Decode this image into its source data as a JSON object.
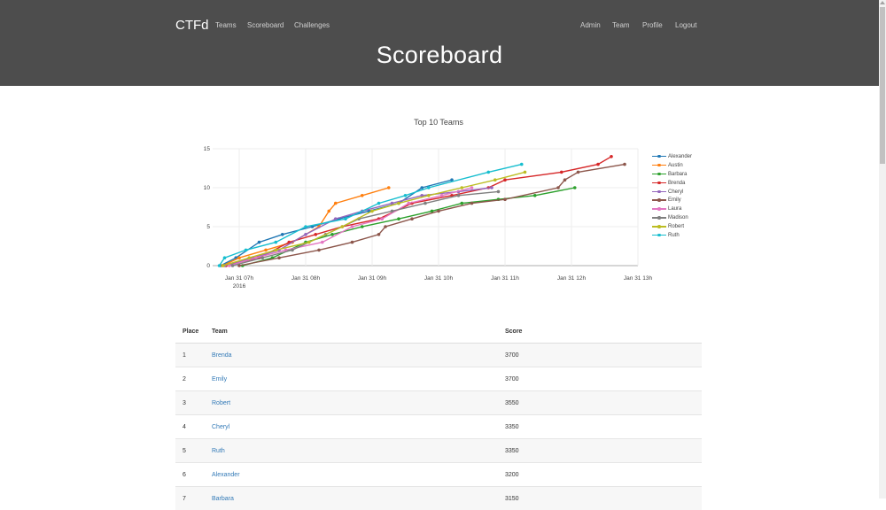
{
  "navbar": {
    "brand": "CTFd",
    "left_links": [
      "Teams",
      "Scoreboard",
      "Challenges"
    ],
    "right_links": [
      "Admin",
      "Team",
      "Profile",
      "Logout"
    ]
  },
  "page_title": "Scoreboard",
  "chart_data": {
    "type": "line",
    "title": "Top 10 Teams",
    "xlabel": "",
    "ylabel": "",
    "x_ticks": [
      "Jan 31 07h\n2016",
      "Jan 31 08h",
      "Jan 31 09h",
      "Jan 31 10h",
      "Jan 31 11h",
      "Jan 31 12h",
      "Jan 31 13h"
    ],
    "y_ticks": [
      0,
      5,
      10,
      15
    ],
    "xlim": [
      6.6,
      13.0
    ],
    "ylim": [
      0,
      15
    ],
    "grid": true,
    "legend": "right",
    "series": [
      {
        "name": "Alexander",
        "color": "#1f77b4",
        "x": [
          6.72,
          6.95,
          7.3,
          7.65,
          8.1,
          8.5,
          8.95,
          9.4,
          9.75,
          10.2
        ],
        "y": [
          0,
          1,
          3,
          4,
          5,
          6,
          7,
          8,
          10,
          11
        ]
      },
      {
        "name": "Austin",
        "color": "#ff7f0e",
        "x": [
          6.75,
          7.0,
          7.4,
          7.8,
          8.2,
          8.35,
          8.45,
          8.85,
          9.25
        ],
        "y": [
          0,
          1,
          2,
          3,
          5,
          7,
          8,
          9,
          10
        ]
      },
      {
        "name": "Barbara",
        "color": "#2ca02c",
        "x": [
          7.05,
          7.5,
          8.0,
          8.4,
          8.85,
          9.4,
          9.9,
          10.35,
          10.9,
          11.45,
          12.05
        ],
        "y": [
          0,
          1,
          3,
          4,
          5,
          6,
          7,
          8,
          8.5,
          9,
          10
        ]
      },
      {
        "name": "Brenda",
        "color": "#d62728",
        "x": [
          6.8,
          7.3,
          7.75,
          8.15,
          8.55,
          9.1,
          9.6,
          10.2,
          10.75,
          11.0,
          11.85,
          12.4,
          12.6
        ],
        "y": [
          0,
          1,
          3,
          4,
          5,
          6,
          8,
          9,
          10,
          11,
          12,
          13,
          14
        ]
      },
      {
        "name": "Cheryl",
        "color": "#9467bd",
        "x": [
          6.78,
          7.2,
          7.6,
          8.0,
          8.45,
          8.85,
          9.3,
          9.75,
          10.3,
          10.8
        ],
        "y": [
          0,
          1,
          2,
          4,
          6,
          7,
          8,
          9,
          9.5,
          10
        ]
      },
      {
        "name": "Emily",
        "color": "#8c564b",
        "x": [
          7.0,
          7.6,
          8.2,
          8.7,
          9.1,
          9.2,
          9.6,
          10.0,
          10.5,
          11.0,
          11.8,
          11.9,
          12.1,
          12.8
        ],
        "y": [
          0,
          1,
          2,
          3,
          4,
          5,
          6,
          7,
          8,
          8.5,
          10,
          11,
          12,
          13
        ]
      },
      {
        "name": "Laura",
        "color": "#e377c2",
        "x": [
          6.85,
          7.25,
          7.7,
          8.25,
          8.7,
          9.15,
          9.55,
          10.05,
          10.5
        ],
        "y": [
          0,
          1,
          2,
          3,
          5,
          6,
          8,
          9,
          10
        ]
      },
      {
        "name": "Madison",
        "color": "#7f7f7f",
        "x": [
          6.9,
          7.35,
          7.8,
          8.3,
          8.8,
          9.3,
          9.8,
          10.3,
          10.9
        ],
        "y": [
          0,
          1,
          2,
          4,
          6,
          7,
          8,
          9,
          9.5
        ]
      },
      {
        "name": "Robert",
        "color": "#bcbd22",
        "x": [
          6.76,
          7.15,
          7.55,
          8.05,
          8.55,
          9.0,
          9.4,
          9.85,
          10.35,
          10.85,
          11.3
        ],
        "y": [
          0,
          1,
          2,
          3,
          5,
          7,
          8,
          9,
          10,
          11,
          12
        ]
      },
      {
        "name": "Ruth",
        "color": "#17becf",
        "x": [
          6.7,
          6.78,
          7.1,
          7.55,
          8.0,
          8.6,
          9.1,
          9.5,
          9.85,
          10.75,
          11.25
        ],
        "y": [
          0,
          1,
          2,
          3,
          5,
          6,
          8,
          9,
          10,
          12,
          13
        ]
      }
    ]
  },
  "table": {
    "columns": [
      "Place",
      "Team",
      "Score"
    ],
    "rows": [
      {
        "place": "1",
        "team": "Brenda",
        "score": "3700"
      },
      {
        "place": "2",
        "team": "Emily",
        "score": "3700"
      },
      {
        "place": "3",
        "team": "Robert",
        "score": "3550"
      },
      {
        "place": "4",
        "team": "Cheryl",
        "score": "3350"
      },
      {
        "place": "5",
        "team": "Ruth",
        "score": "3350"
      },
      {
        "place": "6",
        "team": "Alexander",
        "score": "3200"
      },
      {
        "place": "7",
        "team": "Barbara",
        "score": "3150"
      }
    ]
  }
}
